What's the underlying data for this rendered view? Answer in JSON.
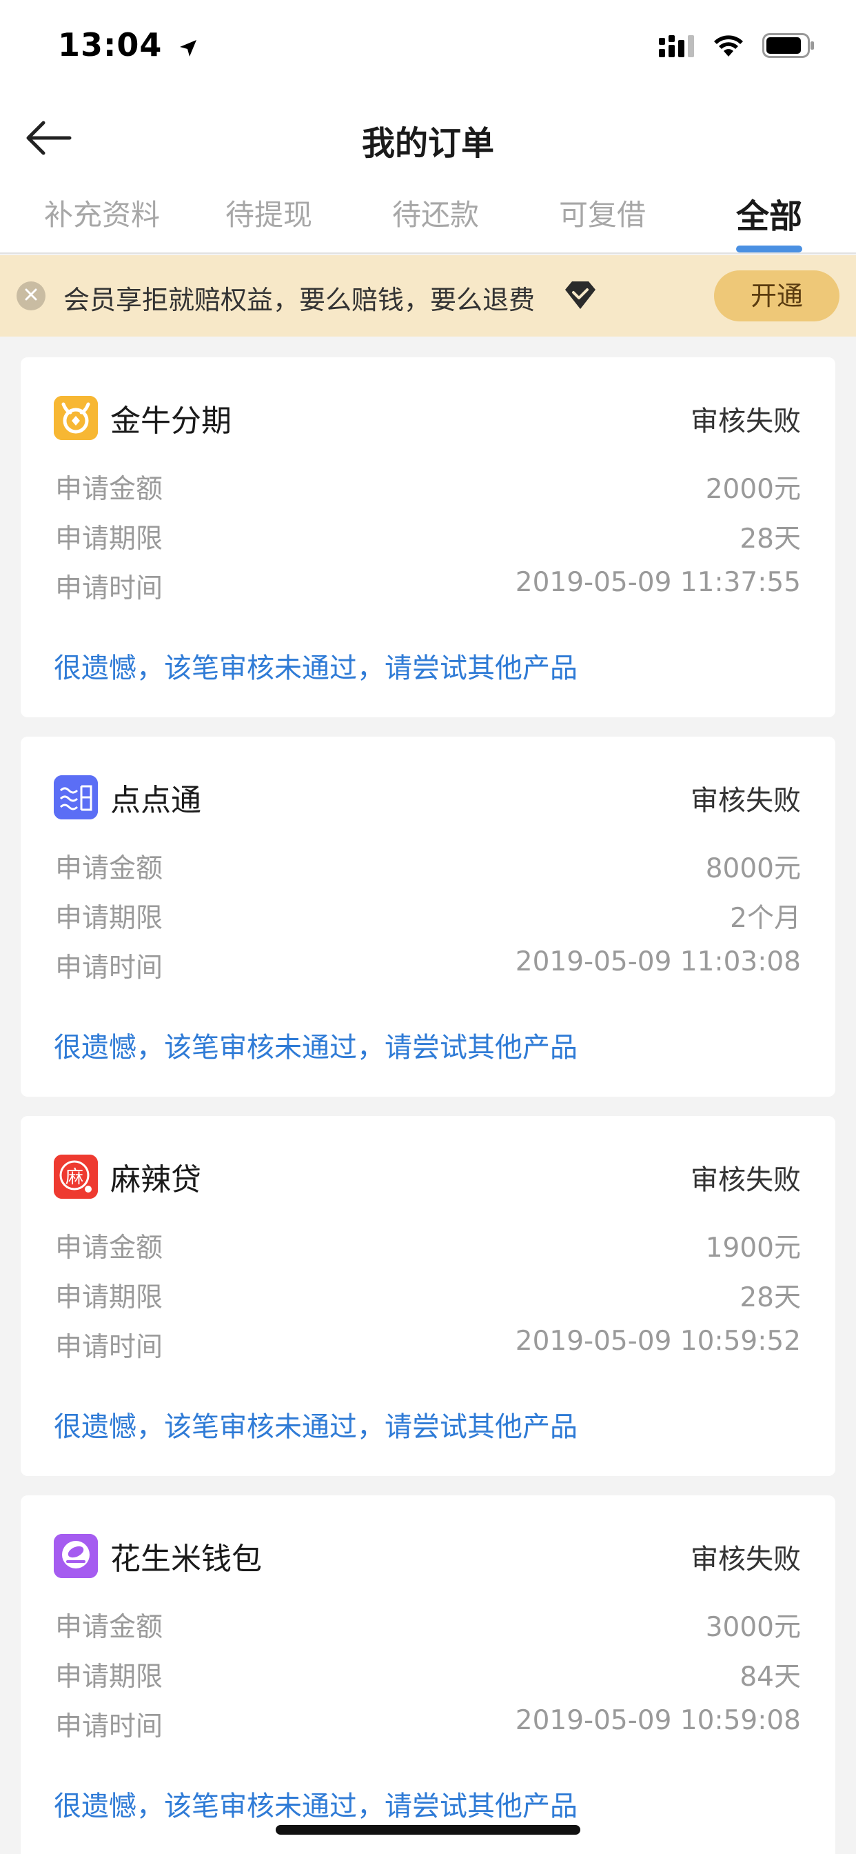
{
  "status_bar": {
    "time": "13:04"
  },
  "nav": {
    "title": "我的订单"
  },
  "tabs": [
    {
      "label": "补充资料",
      "active": false
    },
    {
      "label": "待提现",
      "active": false
    },
    {
      "label": "待还款",
      "active": false
    },
    {
      "label": "可复借",
      "active": false
    },
    {
      "label": "全部",
      "active": true
    }
  ],
  "banner": {
    "text": "会员享拒就赔权益，要么赔钱，要么退费",
    "button_label": "开通"
  },
  "orders": [
    {
      "name": "金牛分期",
      "status": "审核失败",
      "amount_label": "申请金额",
      "amount": "2000元",
      "term_label": "申请期限",
      "term": "28天",
      "time_label": "申请时间",
      "time": "2019-05-09 11:37:55",
      "note": "很遗憾，该笔审核未通过，请尝试其他产品",
      "logo_color": "#f7b733",
      "logo_icon": "bull-icon"
    },
    {
      "name": "点点通",
      "status": "审核失败",
      "amount_label": "申请金额",
      "amount": "8000元",
      "term_label": "申请期限",
      "term": "2个月",
      "time_label": "申请时间",
      "time": "2019-05-09 11:03:08",
      "note": "很遗憾，该笔审核未通过，请尝试其他产品",
      "logo_color": "#5b6ef5",
      "logo_icon": "diandiantong-icon"
    },
    {
      "name": "麻辣贷",
      "status": "审核失败",
      "amount_label": "申请金额",
      "amount": "1900元",
      "term_label": "申请期限",
      "term": "28天",
      "time_label": "申请时间",
      "time": "2019-05-09 10:59:52",
      "note": "很遗憾，该笔审核未通过，请尝试其他产品",
      "logo_color": "#ee3a30",
      "logo_text": "麻",
      "logo_icon": "mala-icon"
    },
    {
      "name": "花生米钱包",
      "status": "审核失败",
      "amount_label": "申请金额",
      "amount": "3000元",
      "term_label": "申请期限",
      "term": "84天",
      "time_label": "申请时间",
      "time": "2019-05-09 10:59:08",
      "note": "很遗憾，该笔审核未通过，请尝试其他产品",
      "logo_color": "#a55cf0",
      "logo_icon": "peanut-icon"
    }
  ],
  "colors": {
    "accent_blue": "#4a90e2",
    "note_blue": "#2f7bd6",
    "banner_bg": "#f7e8c8",
    "banner_button": "#eec878"
  }
}
